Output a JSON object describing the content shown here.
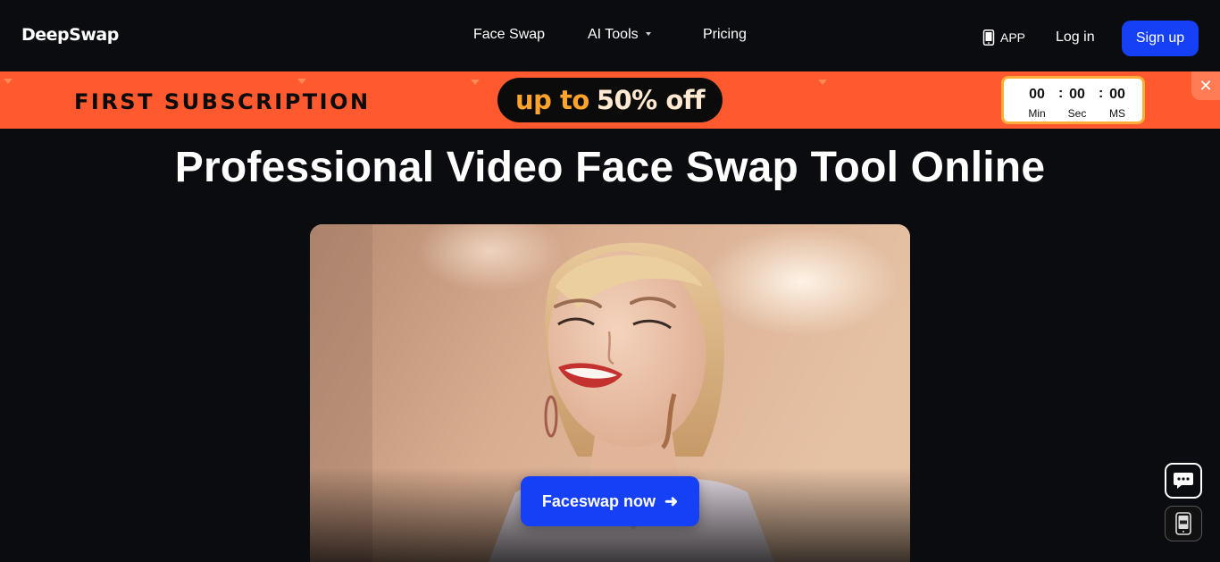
{
  "header": {
    "logo": "DeepSwap",
    "nav": {
      "face_swap": "Face Swap",
      "ai_tools": "AI Tools",
      "pricing": "Pricing"
    },
    "app_label": "APP",
    "login": "Log in",
    "signup": "Sign up"
  },
  "promo": {
    "title": "FIRST SUBSCRIPTION",
    "offer_prefix": "up to",
    "offer_value": "50% off",
    "timer": {
      "minutes": "00",
      "seconds": "00",
      "ms": "00",
      "min_label": "Min",
      "sec_label": "Sec",
      "ms_label": "MS",
      "separator": ":"
    },
    "close_glyph": "✕"
  },
  "hero": {
    "title": "Professional Video Face Swap Tool Online",
    "cta": "Faceswap now",
    "cta_arrow": "➜"
  },
  "colors": {
    "background": "#0b0c10",
    "accent": "#1640f6",
    "promo": "#ff5a2f",
    "promo_highlight": "#ffa42a"
  },
  "icons": [
    "phone-icon",
    "caret-down-icon",
    "close-icon",
    "chat-icon",
    "app-download-icon",
    "arrow-right-icon"
  ]
}
